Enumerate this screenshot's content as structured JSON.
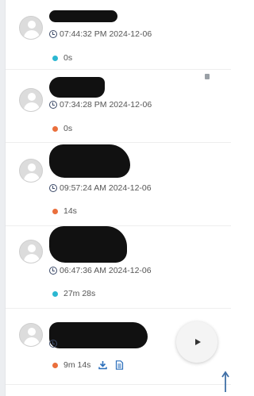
{
  "colors": {
    "status_cyan": "#2bb7d1",
    "status_orange": "#ea6f3c",
    "clock": "#3c4a68",
    "accent_blue": "#2a6ebb"
  },
  "entries": [
    {
      "time": "07:44:32 PM 2024-12-06",
      "duration": "0s",
      "status_color": "cyan"
    },
    {
      "time": "07:34:28 PM 2024-12-06",
      "duration": "0s",
      "status_color": "orange"
    },
    {
      "time": "09:57:24 AM 2024-12-06",
      "duration": "14s",
      "status_color": "orange"
    },
    {
      "time": "06:47:36 AM 2024-12-06",
      "duration": "27m 28s",
      "status_color": "cyan"
    },
    {
      "time": "",
      "duration": "9m 14s",
      "status_color": "orange",
      "icons": [
        "download-icon",
        "document-icon"
      ]
    }
  ],
  "icons": {
    "avatar": "person-avatar-icon",
    "clock": "clock-icon",
    "play": "play-icon",
    "scroll_top": "arrow-up-icon"
  }
}
